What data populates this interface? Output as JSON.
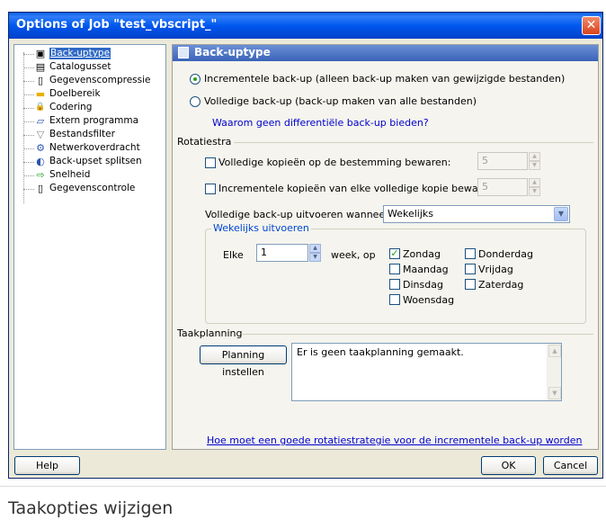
{
  "window": {
    "title": "Options of Job \"test_vbscript_\""
  },
  "tree": {
    "items": [
      {
        "label": "Back-uptype",
        "icon": "backup-type-icon",
        "glyph": "▣",
        "selected": true
      },
      {
        "label": "Catalogusset",
        "icon": "catalog-icon",
        "glyph": "▤"
      },
      {
        "label": "Gegevenscompressie",
        "icon": "compression-icon",
        "glyph": "▯"
      },
      {
        "label": "Doelbereik",
        "icon": "folder-icon",
        "glyph": "▬"
      },
      {
        "label": "Codering",
        "icon": "lock-icon",
        "glyph": "🔒"
      },
      {
        "label": "Extern programma",
        "icon": "program-icon",
        "glyph": "▱"
      },
      {
        "label": "Bestandsfilter",
        "icon": "filter-icon",
        "glyph": "▽"
      },
      {
        "label": "Netwerkoverdracht",
        "icon": "network-icon",
        "glyph": "⚙"
      },
      {
        "label": "Back-upset splitsen",
        "icon": "split-icon",
        "glyph": "◐"
      },
      {
        "label": "Snelheid",
        "icon": "speed-icon",
        "glyph": "⇨"
      },
      {
        "label": "Gegevenscontrole",
        "icon": "verify-icon",
        "glyph": "▯"
      }
    ]
  },
  "panel": {
    "title": "Back-uptype",
    "radio_incremental": "Incrementele back-up (alleen back-up maken van gewijzigde bestanden)",
    "radio_full": "Volledige back-up (back-up maken van alle bestanden)",
    "differential_link": "Waarom geen differentiële back-up bieden?",
    "rotation_label": "Rotatiestra",
    "keep_full_label": "Volledige kopieën op de bestemming bewaren:",
    "keep_full_value": "5",
    "keep_incr_label": "Incrementele kopieën van elke volledige kopie bewaren:",
    "keep_incr_value": "5",
    "full_when_label": "Volledige back-up uitvoeren wanneer",
    "full_when_value": "Wekelijks",
    "weekly_legend": "Wekelijks uitvoeren",
    "every_label": "Elke",
    "every_value": "1",
    "week_label": "week, op",
    "days": [
      {
        "label": "Zondag",
        "checked": true
      },
      {
        "label": "Maandag",
        "checked": false
      },
      {
        "label": "Dinsdag",
        "checked": false
      },
      {
        "label": "Woensdag",
        "checked": false
      },
      {
        "label": "Donderdag",
        "checked": false
      },
      {
        "label": "Vrijdag",
        "checked": false
      },
      {
        "label": "Zaterdag",
        "checked": false
      }
    ],
    "schedule_label": "Taakplanning",
    "schedule_button": "Planning instellen",
    "schedule_text": "Er is geen taakplanning gemaakt.",
    "strategy_link": "Hoe moet een goede rotatiestrategie voor de incrementele back-up worden"
  },
  "buttons": {
    "help": "Help",
    "ok": "OK",
    "cancel": "Cancel"
  },
  "caption": "Taakopties wijzigen",
  "colors": {
    "titlebar": "#0058ee",
    "link": "#0000cc",
    "legend": "#0046d5",
    "check": "#21a121"
  }
}
